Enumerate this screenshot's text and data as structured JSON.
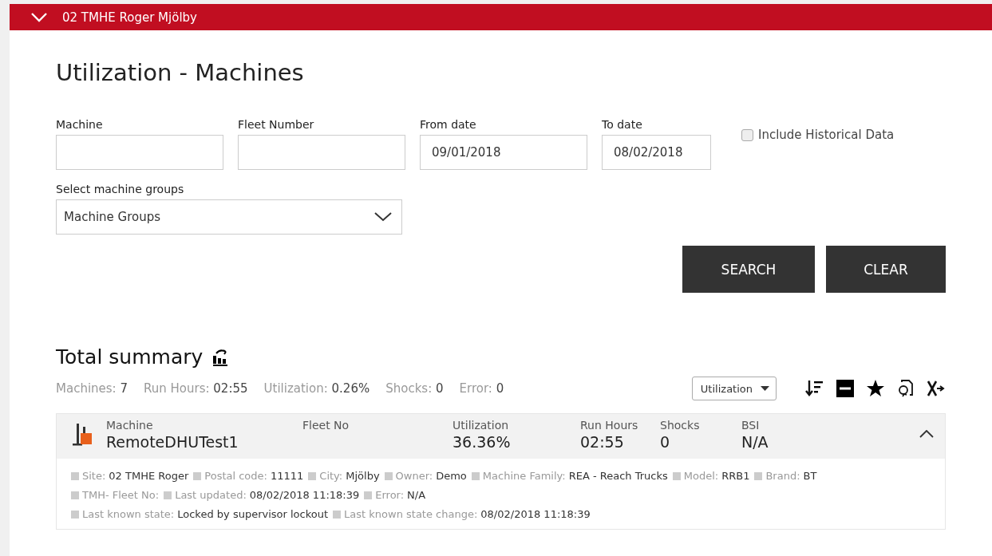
{
  "header": {
    "title": "02 TMHE Roger Mjölby",
    "expanded": true
  },
  "page_title": "Utilization - Machines",
  "fields": [
    {
      "label": "Machine"
    },
    {
      "label": "Fleet Number"
    },
    {
      "label": "From date",
      "value": "09/01/2018"
    },
    {
      "label": "To date",
      "value": "08/02/2018"
    }
  ],
  "include_historical": {
    "label": "Include Historical Data",
    "checked": false
  },
  "machine_groups": {
    "label": "Select machine groups",
    "value": "Machine Groups"
  },
  "buttons": [
    "SEARCH",
    "CLEAR"
  ],
  "summary": {
    "title": "Total summary",
    "stats": [
      {
        "label": "Machines:",
        "value": "7"
      },
      {
        "label": "Run Hours:",
        "value": "02:55"
      },
      {
        "label": "Utilization:",
        "value": "0.26%"
      },
      {
        "label": "Shocks:",
        "value": "0"
      },
      {
        "label": "Error:",
        "value": "0"
      }
    ],
    "sort_select": "Utilization"
  },
  "machines": [
    {
      "expanded": true,
      "columns": [
        {
          "label": "Machine",
          "value": "RemoteDHUTest1"
        },
        {
          "label": "Fleet No"
        },
        {
          "label": "Utilization",
          "value": "36.36%"
        },
        {
          "label": "Run Hours",
          "value": "02:55"
        },
        {
          "label": "Shocks",
          "value": "0"
        },
        {
          "label": "BSI",
          "value": "N/A"
        }
      ],
      "details": [
        [
          {
            "label": "Site:",
            "value": "02 TMHE Roger"
          },
          {
            "label": "Postal code:",
            "value": "11111"
          },
          {
            "label": "City:",
            "value": "Mjölby"
          },
          {
            "label": "Owner:",
            "value": "Demo"
          },
          {
            "label": "Machine Family:",
            "value": "REA - Reach Trucks"
          },
          {
            "label": "Model:",
            "value": "RRB1"
          },
          {
            "label": "Brand:",
            "value": "BT"
          }
        ],
        [
          {
            "label": "TMH- Fleet No:"
          },
          {
            "label": "Last updated:",
            "value": "08/02/2018 11:18:39"
          },
          {
            "label": "Error:",
            "value": "N/A"
          }
        ],
        [
          {
            "label": "Last known state:",
            "value": "Locked by supervisor lockout"
          },
          {
            "label": "Last known state change:",
            "value": "08/02/2018 11:18:39"
          }
        ]
      ]
    }
  ]
}
